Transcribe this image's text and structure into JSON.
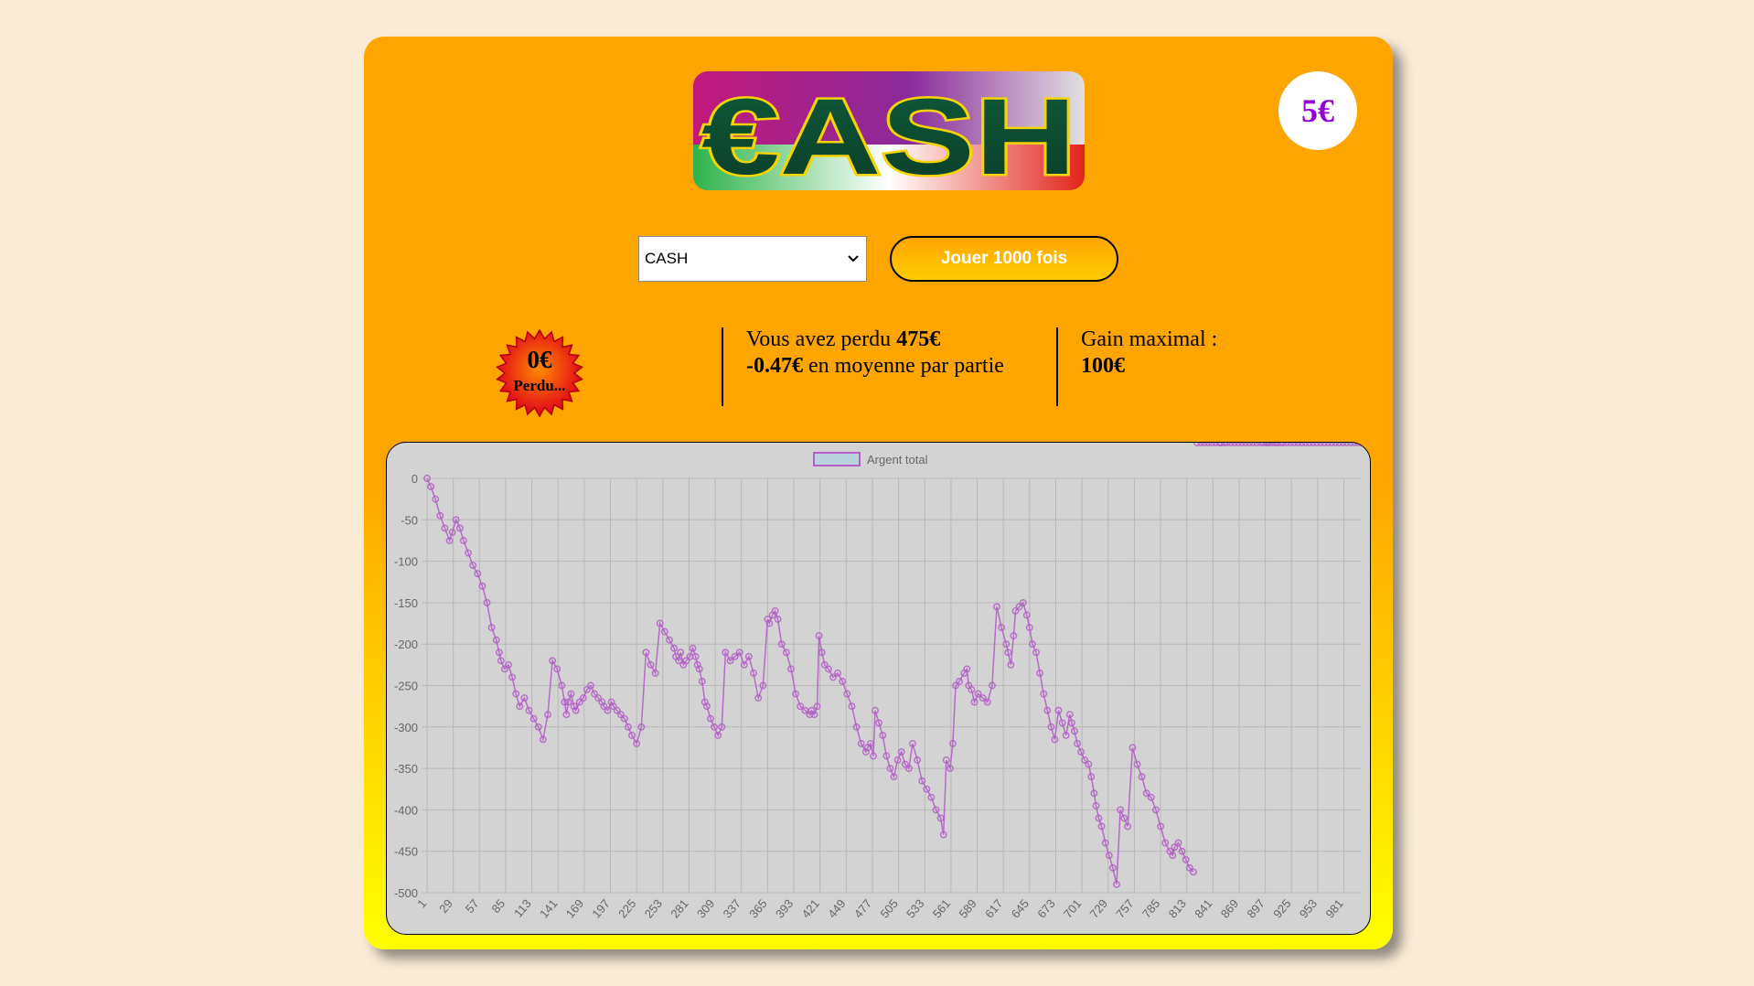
{
  "game": {
    "logo_text": "€ASH",
    "ticket_price": "5€",
    "selected_game": "CASH",
    "play_button_label": "Jouer 1000 fois"
  },
  "last_result": {
    "amount": "0€",
    "label": "Perdu..."
  },
  "stats": {
    "line1_prefix": "Vous avez perdu ",
    "total_lost": "475€",
    "average": "-0.47€",
    "line2_suffix": " en moyenne par partie"
  },
  "gain_max": {
    "label": "Gain maximal :",
    "value": "100€"
  },
  "colors": {
    "background": "#faebd7",
    "card_top": "#ffa500",
    "card_bottom": "#ffff00",
    "price_text": "#9400d3",
    "series_line": "#b35fc6",
    "chart_bg": "#d3d3d3"
  },
  "chart_data": {
    "type": "line",
    "legend": "Argent total",
    "legend_position": "top-center",
    "grid": true,
    "ylim": [
      -500,
      0
    ],
    "y_ticks": [
      0,
      -50,
      -100,
      -150,
      -200,
      -250,
      -300,
      -350,
      -400,
      -450,
      -500
    ],
    "x_range": [
      1,
      1000
    ],
    "x_tick_labels": [
      "1",
      "29",
      "57",
      "85",
      "113",
      "141",
      "169",
      "197",
      "225",
      "253",
      "281",
      "309",
      "337",
      "365",
      "393",
      "421",
      "449",
      "477",
      "505",
      "533",
      "561",
      "589",
      "617",
      "645",
      "673",
      "701",
      "729",
      "757",
      "785",
      "813",
      "841",
      "869",
      "897",
      "925",
      "953",
      "981"
    ],
    "x": [
      1,
      5,
      10,
      15,
      20,
      25,
      28,
      32,
      36,
      40,
      45,
      50,
      55,
      60,
      65,
      70,
      75,
      78,
      80,
      84,
      88,
      92,
      96,
      100,
      105,
      110,
      115,
      120,
      125,
      130,
      135,
      140,
      145,
      148,
      150,
      152,
      155,
      158,
      160,
      164,
      168,
      172,
      176,
      180,
      184,
      188,
      190,
      194,
      198,
      200,
      204,
      208,
      212,
      216,
      220,
      225,
      230,
      235,
      240,
      245,
      250,
      255,
      260,
      265,
      267,
      270,
      272,
      275,
      278,
      282,
      285,
      288,
      290,
      292,
      295,
      298,
      300,
      304,
      308,
      312,
      316,
      320,
      325,
      330,
      335,
      340,
      345,
      350,
      355,
      360,
      365,
      367,
      370,
      373,
      376,
      380,
      385,
      390,
      395,
      400,
      405,
      410,
      412,
      415,
      418,
      420,
      423,
      426,
      430,
      435,
      440,
      445,
      450,
      455,
      460,
      465,
      470,
      472,
      475,
      478,
      480,
      484,
      488,
      492,
      496,
      500,
      504,
      508,
      512,
      516,
      520,
      525,
      530,
      535,
      540,
      545,
      550,
      553,
      556,
      560,
      563,
      566,
      570,
      575,
      578,
      580,
      583,
      586,
      590,
      595,
      600,
      605,
      610,
      615,
      620,
      622,
      625,
      628,
      630,
      634,
      638,
      642,
      645,
      648,
      652,
      656,
      660,
      664,
      668,
      672,
      676,
      680,
      684,
      688,
      690,
      693,
      696,
      700,
      704,
      708,
      711,
      714,
      716,
      719,
      722,
      726,
      730,
      734,
      738,
      742,
      746,
      750,
      755,
      760,
      765,
      770,
      775,
      780,
      785,
      790,
      795,
      798,
      800,
      804,
      808,
      812,
      816,
      820,
      824,
      828,
      832,
      836,
      840,
      844,
      848,
      850,
      853,
      856,
      860,
      864,
      868,
      872,
      876,
      880,
      884,
      888,
      892,
      895,
      898,
      900,
      902,
      905,
      908,
      910,
      913,
      916,
      920,
      924,
      928,
      932,
      936,
      940,
      944,
      948,
      952,
      956,
      960,
      964,
      968,
      972,
      976,
      980,
      984,
      988,
      992,
      996,
      1000
    ],
    "values": [
      0,
      -10,
      -25,
      -45,
      -60,
      -75,
      -65,
      -50,
      -60,
      -75,
      -90,
      -105,
      -115,
      -130,
      -150,
      -180,
      -195,
      -210,
      -220,
      -230,
      -225,
      -240,
      -260,
      -275,
      -265,
      -280,
      -290,
      -300,
      -315,
      -285,
      -220,
      -230,
      -250,
      -270,
      -285,
      -270,
      -260,
      -275,
      -280,
      -270,
      -265,
      -255,
      -250,
      -260,
      -265,
      -270,
      -275,
      -280,
      -270,
      -275,
      -280,
      -285,
      -290,
      -300,
      -310,
      -320,
      -300,
      -210,
      -225,
      -235,
      -175,
      -185,
      -195,
      -205,
      -215,
      -220,
      -210,
      -225,
      -220,
      -215,
      -205,
      -215,
      -225,
      -230,
      -245,
      -270,
      -275,
      -290,
      -300,
      -310,
      -300,
      -210,
      -220,
      -215,
      -210,
      -225,
      -215,
      -235,
      -265,
      -250,
      -170,
      -175,
      -165,
      -160,
      -170,
      -200,
      -210,
      -230,
      -260,
      -275,
      -280,
      -285,
      -280,
      -285,
      -275,
      -190,
      -210,
      -225,
      -230,
      -240,
      -235,
      -245,
      -260,
      -275,
      -300,
      -320,
      -330,
      -325,
      -320,
      -335,
      -280,
      -295,
      -310,
      -335,
      -350,
      -360,
      -340,
      -330,
      -345,
      -350,
      -320,
      -340,
      -365,
      -375,
      -385,
      -400,
      -410,
      -430,
      -340,
      -350,
      -320,
      -250,
      -245,
      -235,
      -230,
      -250,
      -255,
      -270,
      -260,
      -265,
      -270,
      -250,
      -155,
      -180,
      -200,
      -210,
      -225,
      -190,
      -160,
      -155,
      -150,
      -165,
      -180,
      -200,
      -210,
      -235,
      -260,
      -280,
      -300,
      -315,
      -280,
      -295,
      -310,
      -285,
      -295,
      -305,
      -320,
      -330,
      -340,
      -345,
      -360,
      -380,
      -395,
      -410,
      -420,
      -440,
      -455,
      -470,
      -490,
      -400,
      -410,
      -420,
      -325,
      -345,
      -360,
      -380,
      -385,
      -400,
      -420,
      -440,
      -450,
      -455,
      -445,
      -440,
      -450,
      -460,
      -470,
      -475
    ]
  }
}
